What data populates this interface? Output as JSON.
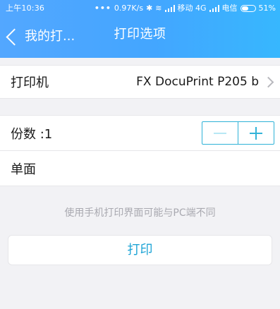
{
  "status_bar": {
    "time": "上午10:36",
    "network_speed": "0.97K/s",
    "carrier_1": "移动 4G",
    "carrier_2": "电信",
    "battery": "51%",
    "battery_level": 0.51,
    "icons": [
      "more-dots-icon",
      "bluetooth-icon",
      "wifi-icon",
      "signal-icon",
      "signal-icon",
      "battery-icon"
    ]
  },
  "nav": {
    "back_label": "我的打...",
    "title": "打印选项"
  },
  "printer": {
    "label": "打印机",
    "value": "FX DocuPrint P205 b"
  },
  "copies": {
    "label": "份数 :1"
  },
  "duplex": {
    "label": "单面"
  },
  "notice": "使用手机打印界面可能与PC端不同",
  "actions": {
    "print": "打印"
  },
  "colors": {
    "header_gradient": [
      "#53a7ff",
      "#37b7fe"
    ],
    "accent": "#20a5d6",
    "stepper_border": "#2fb2d7"
  }
}
